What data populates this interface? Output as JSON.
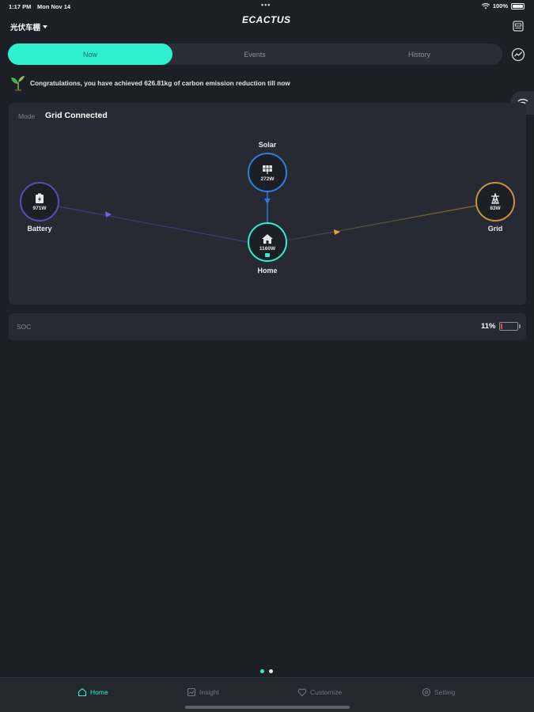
{
  "status_bar": {
    "time": "1:17 PM",
    "date": "Mon Nov 14",
    "dots": "•••",
    "battery": "100%"
  },
  "header": {
    "brand": "ECACTUS",
    "station_name": "光伏车棚"
  },
  "tabs": [
    {
      "label": "Now",
      "active": true
    },
    {
      "label": "Events",
      "active": false
    },
    {
      "label": "History",
      "active": false
    }
  ],
  "congrats": {
    "text": "Congratulations, you have achieved 626.81kg of carbon emission reduction till now"
  },
  "flow": {
    "mode_label": "Mode",
    "mode_value": "Grid Connected",
    "solar": {
      "label": "Solar",
      "value": "272W",
      "color": "#2d7fe0"
    },
    "battery": {
      "label": "Battery",
      "value": "971W",
      "color": "#7b5ed6"
    },
    "home": {
      "label": "Home",
      "value": "1160W",
      "color": "#2ef0cf"
    },
    "grid": {
      "label": "Grid",
      "value": "83W",
      "color": "#e6a23c"
    }
  },
  "soc": {
    "label": "SOC",
    "value": "11%",
    "level": 0.11,
    "level_color": "#e5484d"
  },
  "pager": {
    "count": 2,
    "active_index": 0
  },
  "bottom_nav": [
    {
      "label": "Home",
      "icon": "home-icon",
      "active": true
    },
    {
      "label": "Insight",
      "icon": "insight-icon",
      "active": false
    },
    {
      "label": "Customize",
      "icon": "heart-icon",
      "active": false
    },
    {
      "label": "Setting",
      "icon": "gear-icon",
      "active": false
    }
  ],
  "colors": {
    "accent": "#2ef0cf",
    "background": "#1d1f26",
    "card": "#272a33"
  }
}
